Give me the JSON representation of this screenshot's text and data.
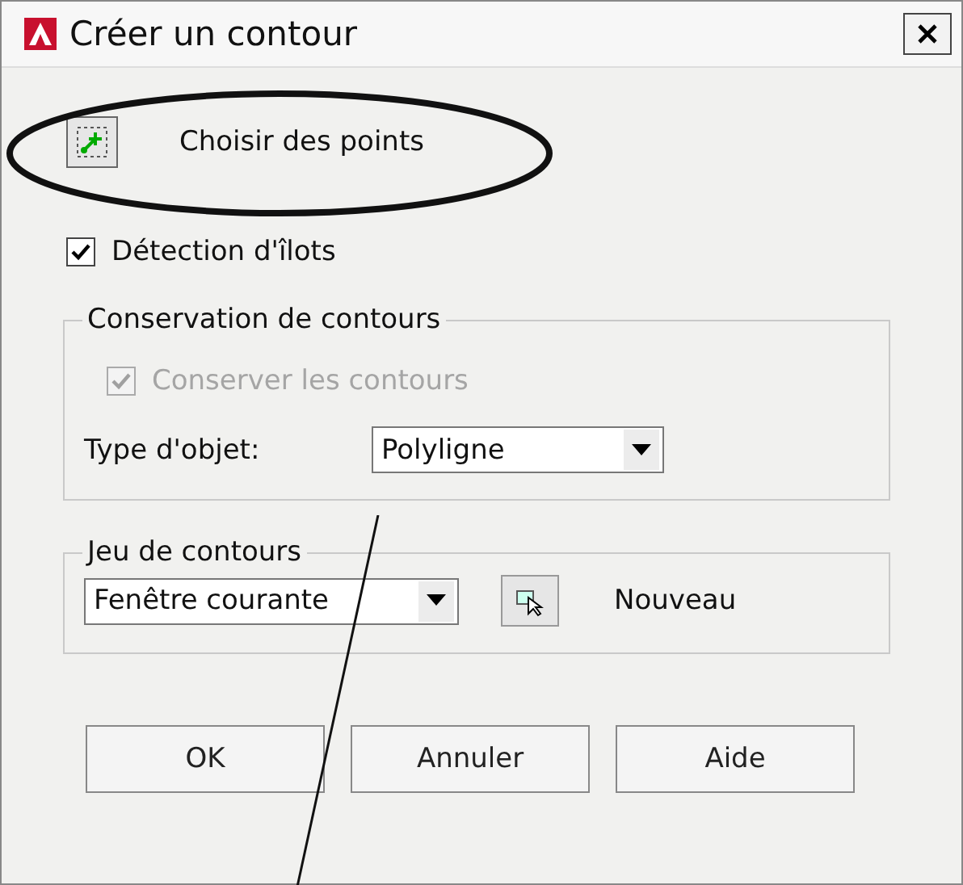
{
  "window": {
    "title": "Créer un contour"
  },
  "pick_points": {
    "label": "Choisir des points"
  },
  "island_detection": {
    "label": "Détection d'îlots",
    "checked": true,
    "disabled": false
  },
  "retention": {
    "title": "Conservation de contours",
    "retain": {
      "label": "Conserver les contours",
      "checked": true,
      "disabled": true
    },
    "object_type": {
      "label": "Type d'objet:",
      "value": "Polyligne"
    }
  },
  "boundary_set": {
    "title": "Jeu de contours",
    "value": "Fenêtre courante",
    "new_label": "Nouveau"
  },
  "buttons": [
    "OK",
    "Annuler",
    "Aide"
  ]
}
